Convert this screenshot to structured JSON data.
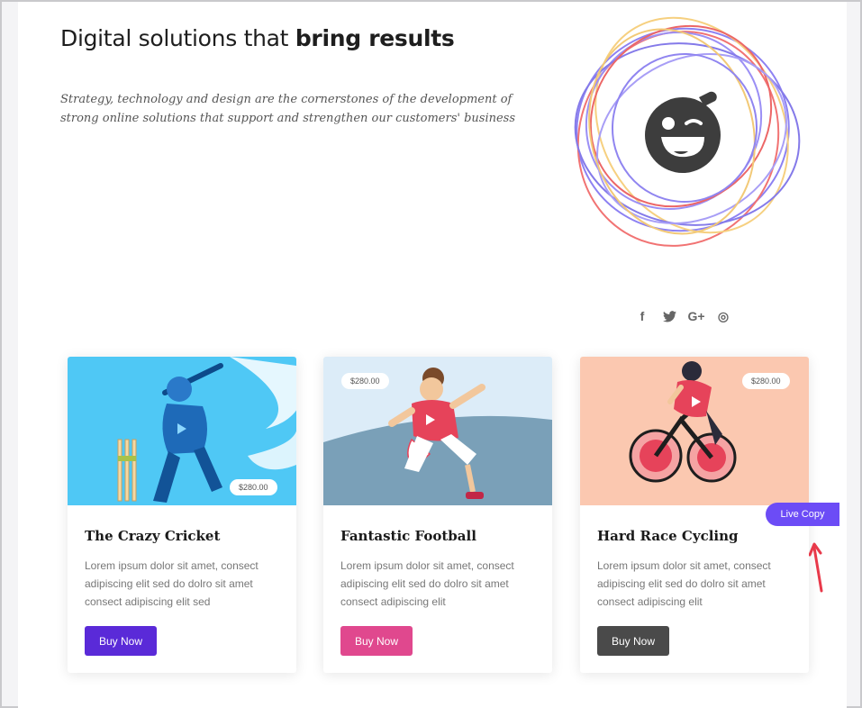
{
  "hero": {
    "title_regular": "Digital solutions that ",
    "title_bold": "bring results",
    "subtitle": "Strategy, technology and design are the cornerstones of the development of strong online solutions that support and strengthen our customers' business"
  },
  "social": {
    "icons": [
      "facebook-icon",
      "twitter-icon",
      "google-plus-icon",
      "dribbble-icon"
    ],
    "facebook": "f",
    "twitter": "t",
    "google_plus": "G+",
    "dribbble": "◎"
  },
  "cards": [
    {
      "title": "The Crazy Cricket",
      "description": "Lorem ipsum dolor sit amet, consect adipiscing elit sed do dolro sit amet consect adipiscing elit sed",
      "price": "$280.00",
      "button": "Buy Now",
      "button_color": "#5a2ad8",
      "image_bg": "#4fc8f5"
    },
    {
      "title": "Fantastic Football",
      "description": "Lorem ipsum dolor sit amet, consect adipiscing elit sed do dolro sit amet consect adipiscing elit",
      "price": "$280.00",
      "button": "Buy Now",
      "button_color": "#e0488e",
      "image_bg": "#dcecf8"
    },
    {
      "title": "Hard Race Cycling",
      "description": "Lorem ipsum dolor sit amet, consect adipiscing elit sed do dolro sit amet consect adipiscing elit",
      "price": "$280.00",
      "button": "Buy Now",
      "button_color": "#4a4a4a",
      "image_bg": "#fbc8b0"
    }
  ],
  "live_copy": {
    "label": "Live Copy",
    "color": "#6c4cf6"
  },
  "colors": {
    "accent_red": "#e8394a"
  }
}
